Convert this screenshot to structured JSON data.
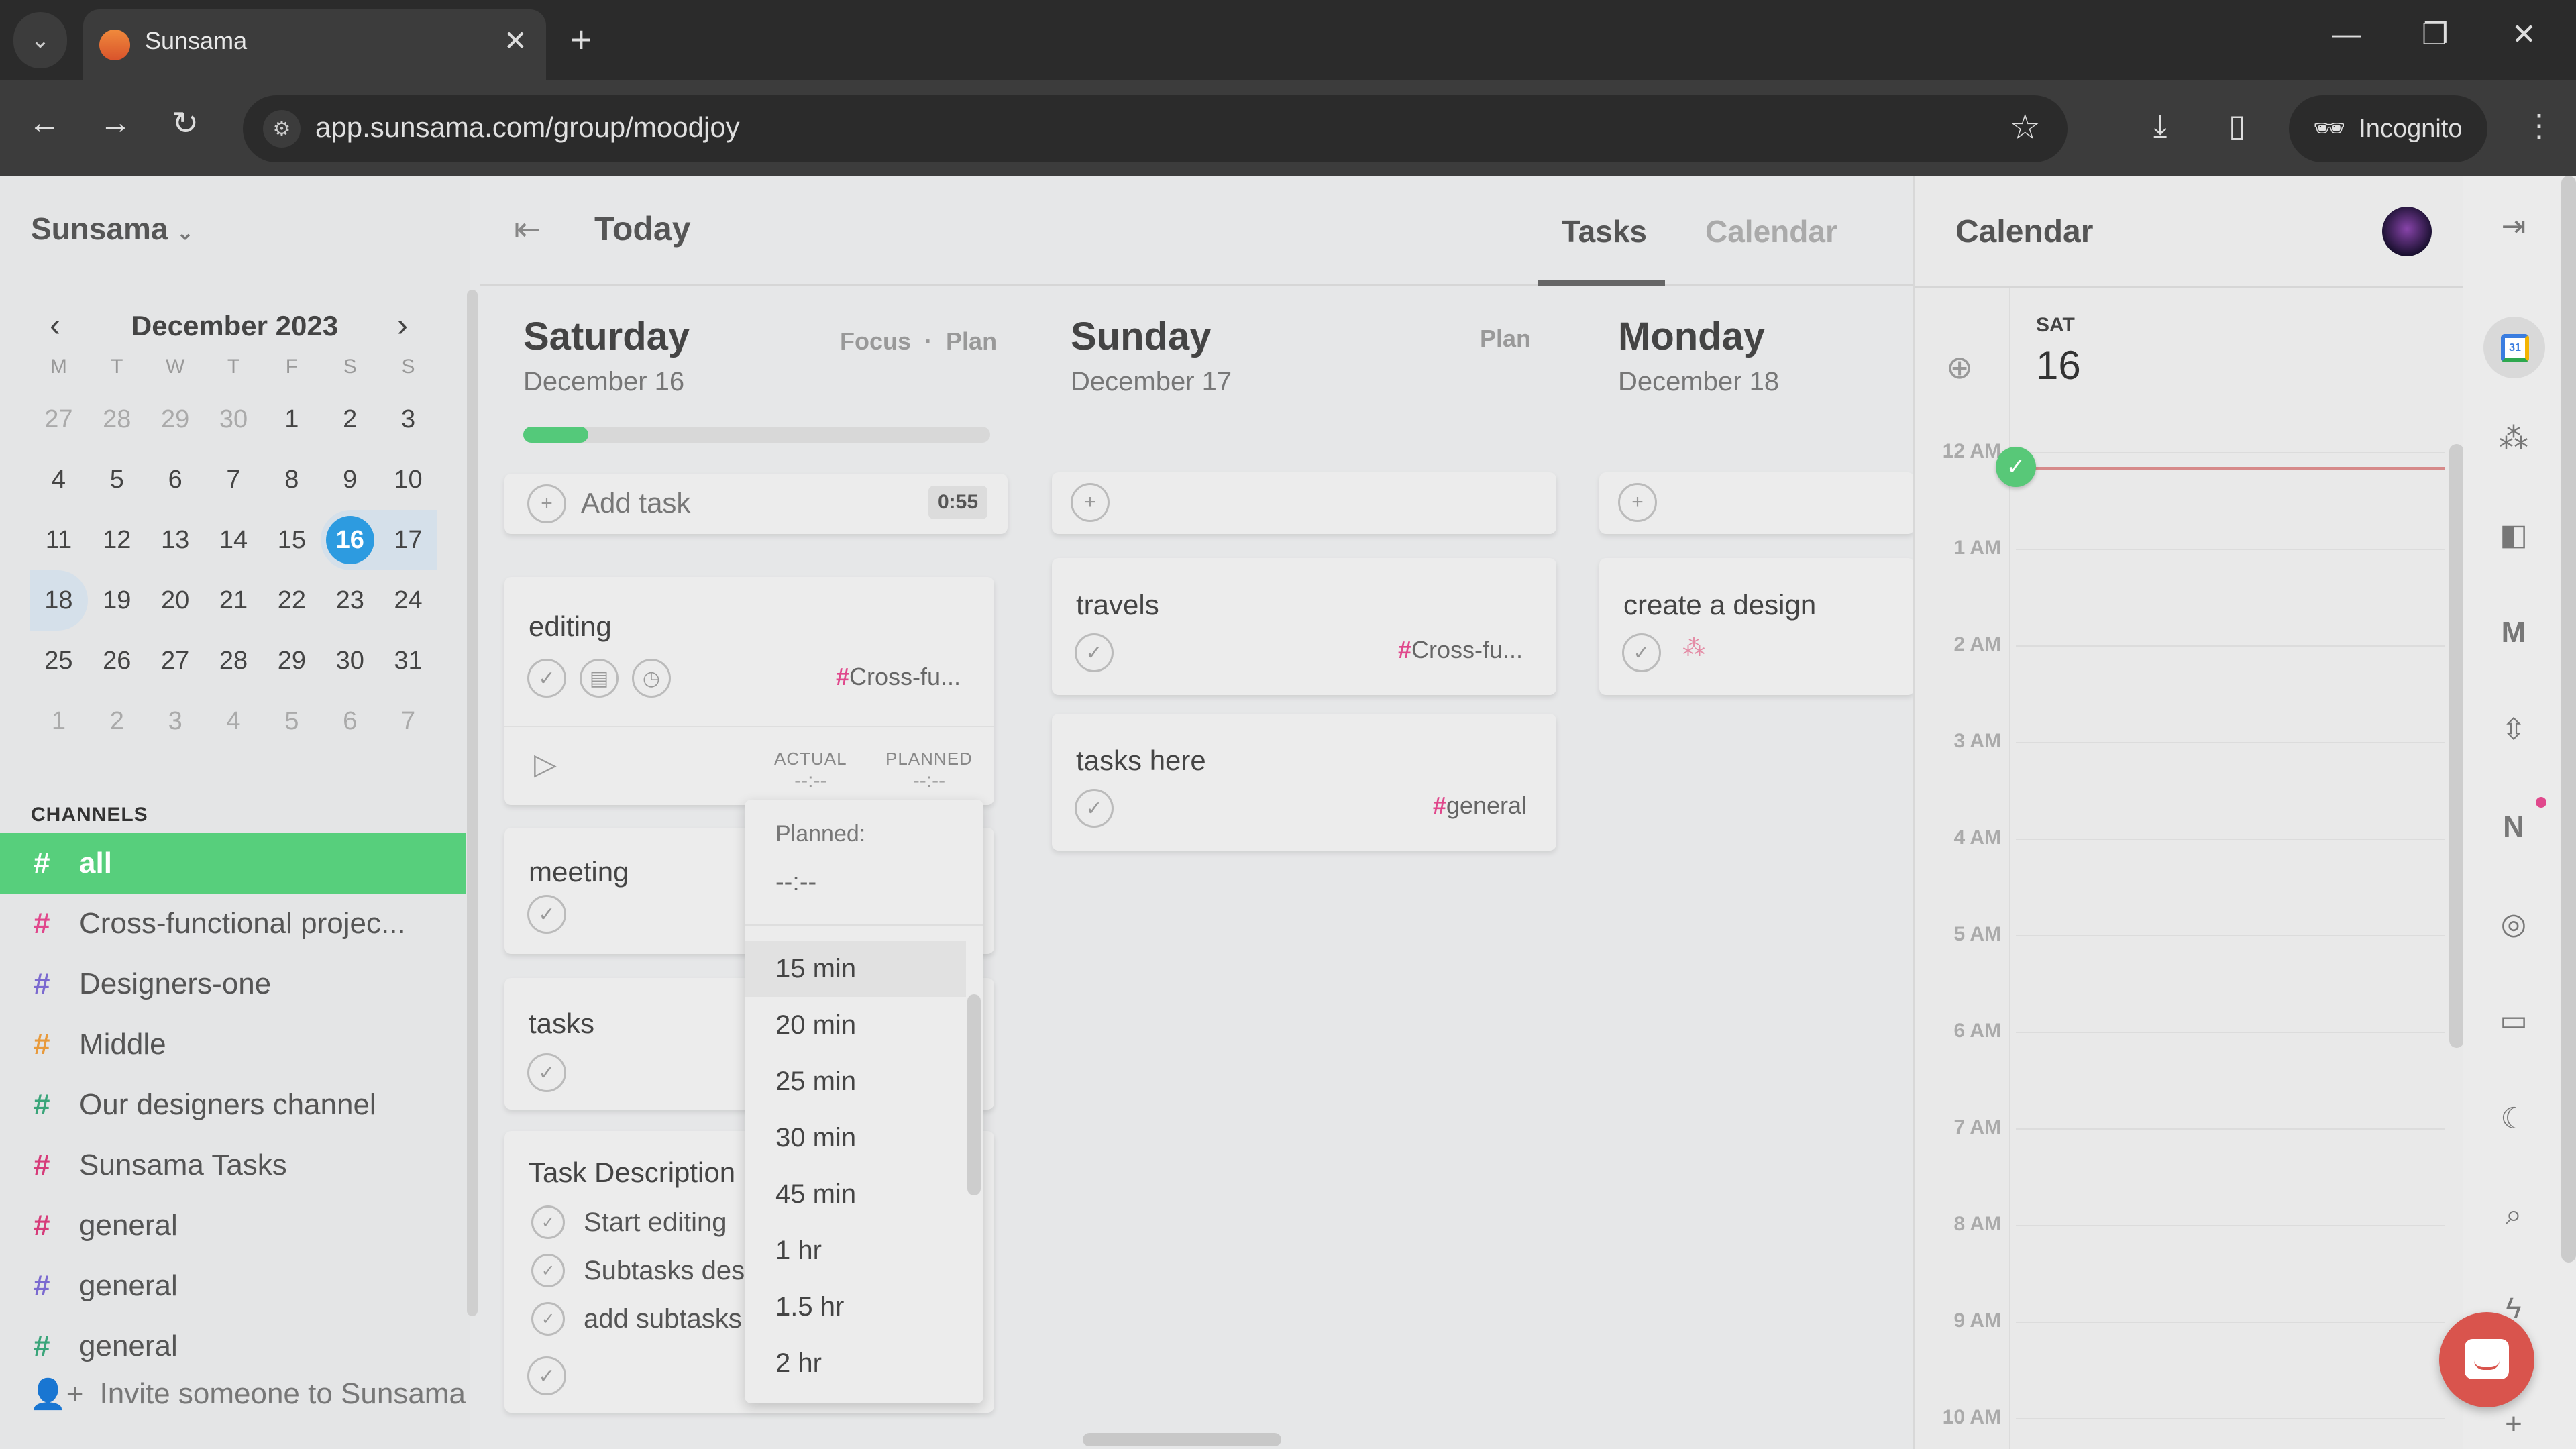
{
  "browser": {
    "tab_title": "Sunsama",
    "url": "app.sunsama.com/group/moodjoy",
    "incognito_label": "Incognito"
  },
  "sidebar": {
    "workspace": "Sunsama",
    "calendar": {
      "month_label": "December 2023",
      "weekdays": [
        "M",
        "T",
        "W",
        "T",
        "F",
        "S",
        "S"
      ],
      "weeks": [
        [
          "27",
          "28",
          "29",
          "30",
          "1",
          "2",
          "3"
        ],
        [
          "4",
          "5",
          "6",
          "7",
          "8",
          "9",
          "10"
        ],
        [
          "11",
          "12",
          "13",
          "14",
          "15",
          "16",
          "17"
        ],
        [
          "18",
          "19",
          "20",
          "21",
          "22",
          "23",
          "24"
        ],
        [
          "25",
          "26",
          "27",
          "28",
          "29",
          "30",
          "31"
        ],
        [
          "1",
          "2",
          "3",
          "4",
          "5",
          "6",
          "7"
        ]
      ],
      "selected_day": "16"
    },
    "channels_header": "CHANNELS",
    "channels": [
      {
        "label": "all",
        "color": "#ffffff",
        "active": true
      },
      {
        "label": "Cross-functional projec...",
        "color": "#e0488c"
      },
      {
        "label": "Designers-one",
        "color": "#7b6ad0"
      },
      {
        "label": "Middle",
        "color": "#e89a3c"
      },
      {
        "label": "Our designers channel",
        "color": "#3aa57a"
      },
      {
        "label": "Sunsama Tasks",
        "color": "#d63c7a"
      },
      {
        "label": "general",
        "color": "#d63c7a"
      },
      {
        "label": "general",
        "color": "#7b6ad0"
      },
      {
        "label": "general",
        "color": "#3aa57a"
      }
    ],
    "invite_label": "Invite someone to Sunsama"
  },
  "header": {
    "title": "Today",
    "tabs": [
      {
        "label": "Tasks",
        "active": true
      },
      {
        "label": "Calendar",
        "active": false
      }
    ]
  },
  "days": [
    {
      "name": "Saturday",
      "date": "December 16",
      "links": [
        "Focus",
        "Plan"
      ],
      "link_sep": "·",
      "progress": 0.14,
      "add_task_label": "Add task",
      "total_time": "0:55",
      "tasks": [
        {
          "title": "editing",
          "channel": "Cross-fu...",
          "actual_label": "ACTUAL",
          "actual_value": "--:--",
          "planned_label": "PLANNED",
          "planned_value": "--:--"
        },
        {
          "title": "meeting"
        },
        {
          "title": "tasks"
        },
        {
          "title": "Task Description",
          "subtasks": [
            "Start editing",
            "Subtasks des",
            "add subtasks"
          ]
        }
      ]
    },
    {
      "name": "Sunday",
      "date": "December 17",
      "links": [
        "Plan"
      ],
      "tasks": [
        {
          "title": "travels",
          "channel": "Cross-fu..."
        },
        {
          "title": "tasks here",
          "channel": "general"
        }
      ]
    },
    {
      "name": "Monday",
      "date": "December 18",
      "tasks": [
        {
          "title": "create a design"
        }
      ]
    }
  ],
  "planned_dropdown": {
    "label": "Planned:",
    "value": "--:--",
    "options": [
      "15 min",
      "20 min",
      "25 min",
      "30 min",
      "45 min",
      "1 hr",
      "1.5 hr",
      "2 hr"
    ],
    "hovered": "15 min"
  },
  "calendar_pane": {
    "title": "Calendar",
    "day_abbr": "SAT",
    "day_num": "16",
    "hours": [
      "12 AM",
      "1 AM",
      "2 AM",
      "3 AM",
      "4 AM",
      "5 AM",
      "6 AM",
      "7 AM",
      "8 AM",
      "9 AM",
      "10 AM"
    ]
  },
  "colors": {
    "accent_green": "#57cf7c",
    "today_blue": "#2d9be0",
    "channel_pink": "#e0488c",
    "chat_red": "#d9544d"
  }
}
